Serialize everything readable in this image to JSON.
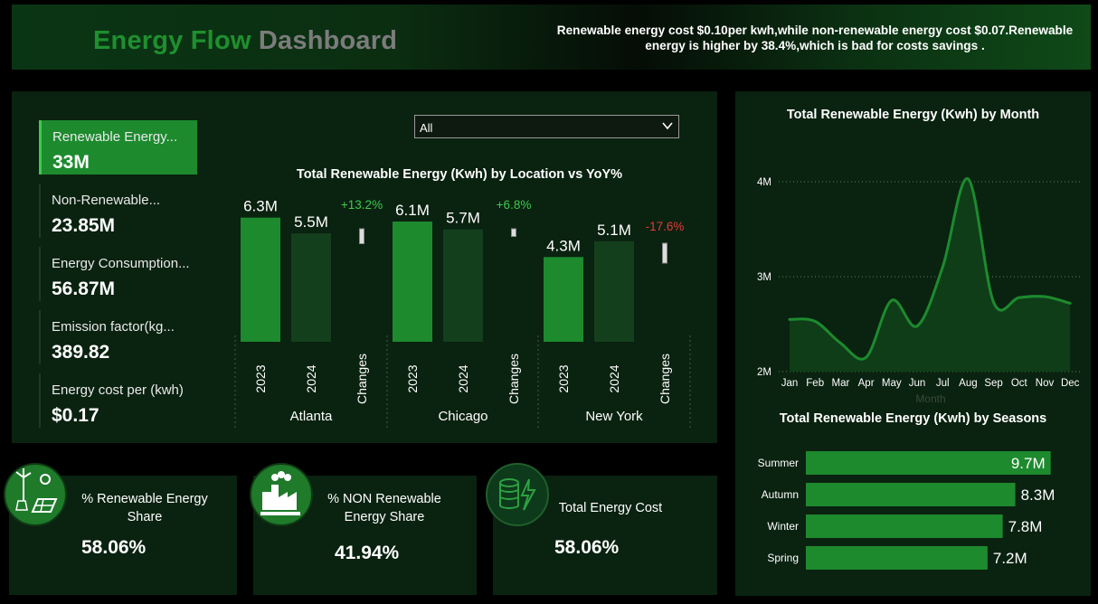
{
  "header": {
    "title_part1": "Energy Flow",
    "title_part2": "Dashboard",
    "insight": "Renewable energy cost $0.10per kwh,while non-renewable energy cost $0.07.Renewable energy is higher by 38.4%,which is bad for costs savings ."
  },
  "kpis": [
    {
      "label": "Renewable Energy...",
      "value": "33M",
      "active": true
    },
    {
      "label": "Non-Renewable...",
      "value": "23.85M",
      "active": false
    },
    {
      "label": "Energy Consumption...",
      "value": "56.87M",
      "active": false
    },
    {
      "label": "Emission factor(kg...",
      "value": "389.82",
      "active": false
    },
    {
      "label": "Energy cost per (kwh)",
      "value": "$0.17",
      "active": false
    }
  ],
  "filter": {
    "value": "All"
  },
  "colors": {
    "bar_2023": "#1d8a2e",
    "bar_2024": "#133f1d",
    "positive": "#3ccb4e",
    "negative": "#e53935",
    "line": "#1d8a2e",
    "area": "#0e3d18"
  },
  "chart_data": [
    {
      "type": "bar",
      "title": "Total Renewable Energy (Kwh) by Location vs YoY%",
      "groups": [
        {
          "location": "Atlanta",
          "2023": 6.3,
          "2024": 5.5,
          "labels": [
            "6.3M",
            "5.5M"
          ],
          "change": "+13.2%",
          "change_value": 13.2
        },
        {
          "location": "Chicago",
          "2023": 6.1,
          "2024": 5.7,
          "labels": [
            "6.1M",
            "5.7M"
          ],
          "change": "+6.8%",
          "change_value": 6.8
        },
        {
          "location": "New York",
          "2023": 4.3,
          "2024": 5.1,
          "labels": [
            "4.3M",
            "5.1M"
          ],
          "change": "-17.6%",
          "change_value": -17.6
        }
      ],
      "sub_categories": [
        "2023",
        "2024",
        "Changes"
      ],
      "unit": "M"
    },
    {
      "type": "area",
      "title": "Total Renewable Energy (Kwh) by Month",
      "xlabel": "Month",
      "categories": [
        "Jan",
        "Feb",
        "Mar",
        "Apr",
        "May",
        "Jun",
        "Jul",
        "Aug",
        "Sep",
        "Oct",
        "Nov",
        "Dec"
      ],
      "values": [
        2.55,
        2.53,
        2.3,
        2.15,
        2.75,
        2.48,
        3.1,
        4.03,
        2.73,
        2.78,
        2.79,
        2.72
      ],
      "yticks": [
        "2M",
        "3M",
        "4M"
      ],
      "ylim": [
        2,
        4.15
      ],
      "grid": true
    },
    {
      "type": "bar",
      "orientation": "horizontal",
      "title": "Total Renewable Energy (Kwh) by Seasons",
      "categories": [
        "Summer",
        "Autumn",
        "Winter",
        "Spring"
      ],
      "values": [
        9.7,
        8.3,
        7.8,
        7.2
      ],
      "labels": [
        "9.7M",
        "8.3M",
        "7.8M",
        "7.2M"
      ]
    }
  ],
  "cards": [
    {
      "label_line1": "% Renewable Energy",
      "label_line2": "Share",
      "value": "58.06%",
      "icon": "solar-wind-icon"
    },
    {
      "label_line1": "% NON Renewable",
      "label_line2": "Energy Share",
      "value": "41.94%",
      "icon": "factory-icon"
    },
    {
      "label_line1": "Total Energy Cost",
      "label_line2": "",
      "value": "58.06%",
      "icon": "coins-bolt-icon"
    }
  ]
}
